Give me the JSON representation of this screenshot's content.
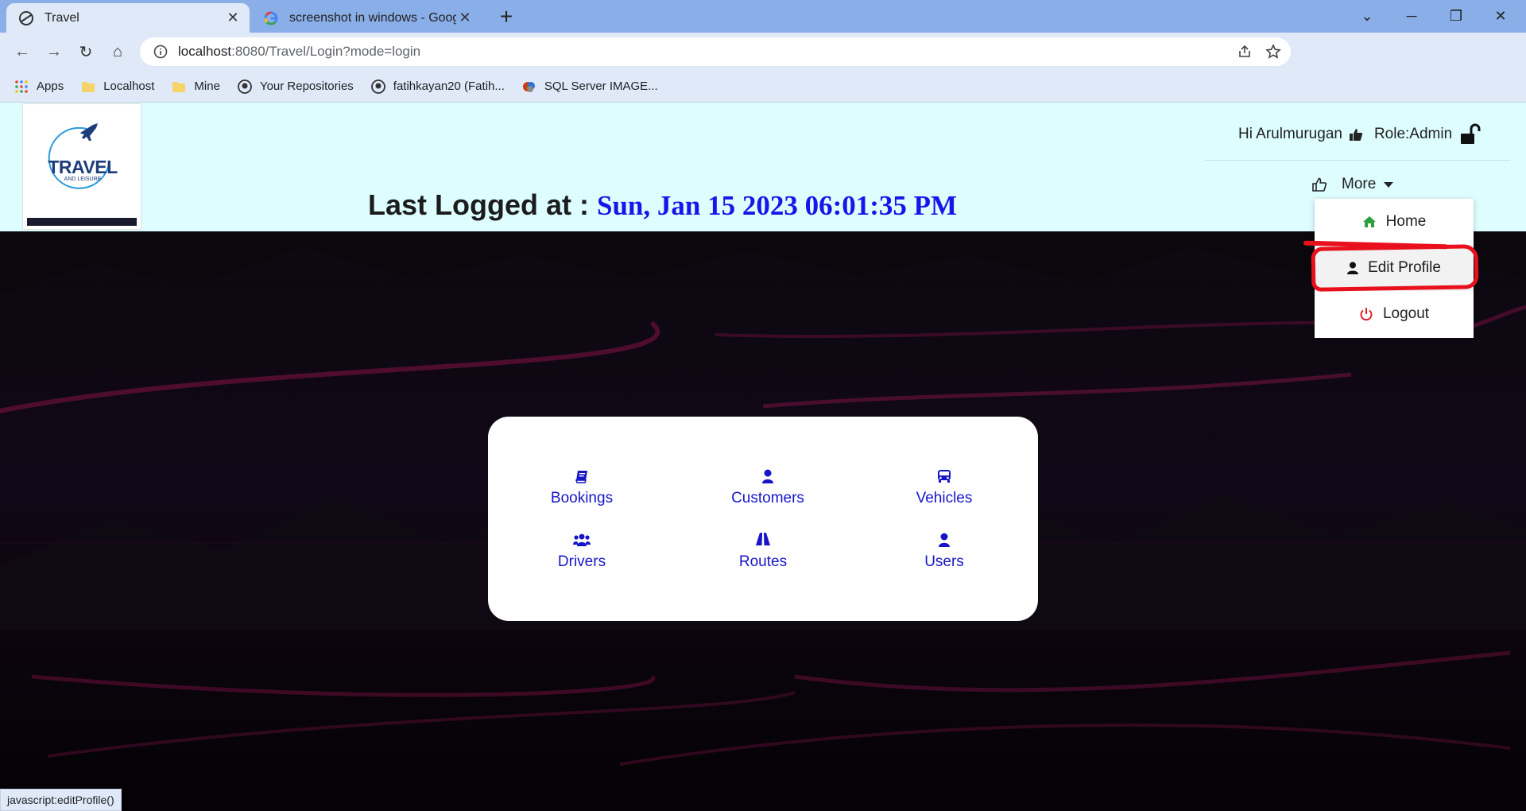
{
  "browser": {
    "tabs": [
      {
        "title": "Travel",
        "icon": "travel-favicon-icon",
        "active": true
      },
      {
        "title": "screenshot in windows - Google",
        "icon": "google-icon",
        "active": false
      }
    ],
    "url": {
      "host": "localhost",
      "path": ":8080/Travel/Login?mode=login"
    },
    "bookmarks": [
      {
        "label": "Apps",
        "icon": "apps-grid-icon"
      },
      {
        "label": "Localhost",
        "icon": "folder-icon"
      },
      {
        "label": "Mine",
        "icon": "folder-icon"
      },
      {
        "label": "Your Repositories",
        "icon": "github-icon"
      },
      {
        "label": "fatihkayan20 (Fatih...",
        "icon": "github-icon"
      },
      {
        "label": "SQL Server IMAGE...",
        "icon": "sql-server-icon"
      }
    ],
    "status_text": "javascript:editProfile()"
  },
  "header": {
    "logo_text": "TRAVEL",
    "logo_sub": "AND LEISURE",
    "last_logged_label": "Last Logged at : ",
    "last_logged_value": "Sun, Jan 15 2023 06:01:35 PM",
    "greeting": "Hi Arulmurugan",
    "role": "Role:Admin",
    "more_label": "More"
  },
  "dropdown": {
    "items": [
      {
        "label": "Home",
        "icon": "home-icon",
        "color": "#2e9e3e"
      },
      {
        "label": "Edit Profile",
        "icon": "user-icon",
        "color": "#111111"
      },
      {
        "label": "Logout",
        "icon": "power-icon",
        "color": "#e0202a"
      }
    ]
  },
  "menu": {
    "items": [
      {
        "label": "Bookings",
        "icon": "book-icon"
      },
      {
        "label": "Customers",
        "icon": "user-icon"
      },
      {
        "label": "Vehicles",
        "icon": "bus-icon"
      },
      {
        "label": "Drivers",
        "icon": "users-icon"
      },
      {
        "label": "Routes",
        "icon": "road-icon"
      },
      {
        "label": "Users",
        "icon": "user-icon"
      }
    ]
  },
  "colors": {
    "accent_link": "#1616c8",
    "header_bg": "#ddfdff",
    "annotation": "#e8101c",
    "timestamp": "#1616e8"
  }
}
